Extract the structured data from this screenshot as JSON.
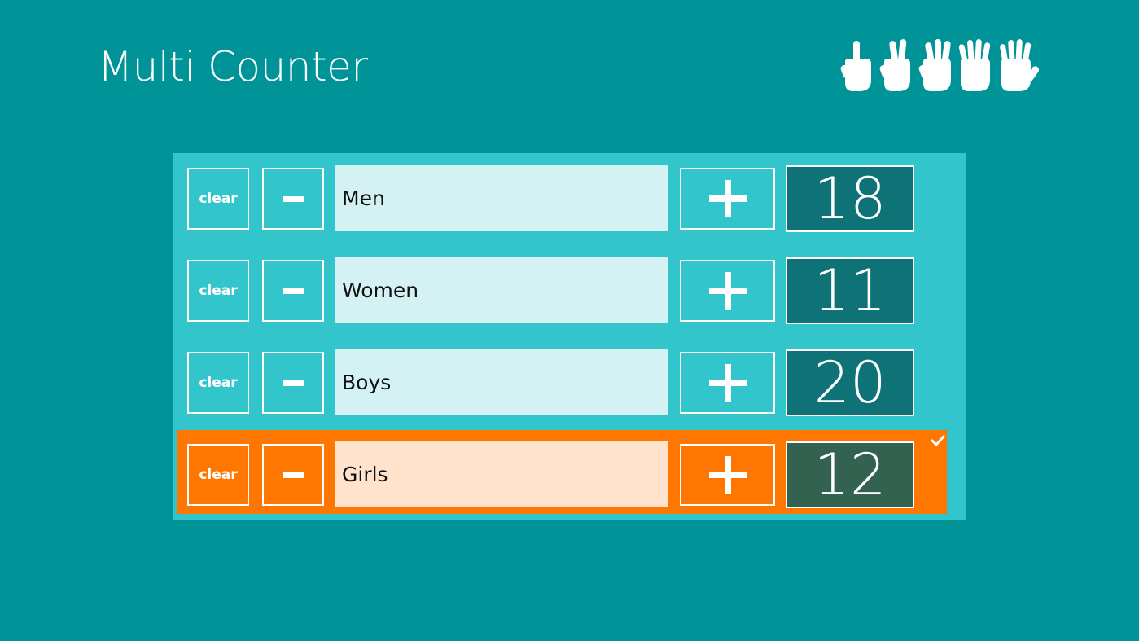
{
  "app": {
    "title": "Multi Counter",
    "logo_icon": "counting-hands-icon"
  },
  "colors": {
    "background": "#009398",
    "panel": "#33c5cc",
    "selected_row": "#ff7700",
    "name_field": "#d4f2f4",
    "name_field_selected": "#ffe3cc",
    "count_box": "#0e7276",
    "count_box_selected": "#346250"
  },
  "counters": [
    {
      "clear_label": "clear",
      "name": "Men",
      "count": "18",
      "selected": false
    },
    {
      "clear_label": "clear",
      "name": "Women",
      "count": "11",
      "selected": false
    },
    {
      "clear_label": "clear",
      "name": "Boys",
      "count": "20",
      "selected": false
    },
    {
      "clear_label": "clear",
      "name": "Girls",
      "count": "12",
      "selected": true
    }
  ],
  "icons": {
    "minus": "minus-icon",
    "plus": "plus-icon",
    "selected": "checkmark-icon"
  }
}
